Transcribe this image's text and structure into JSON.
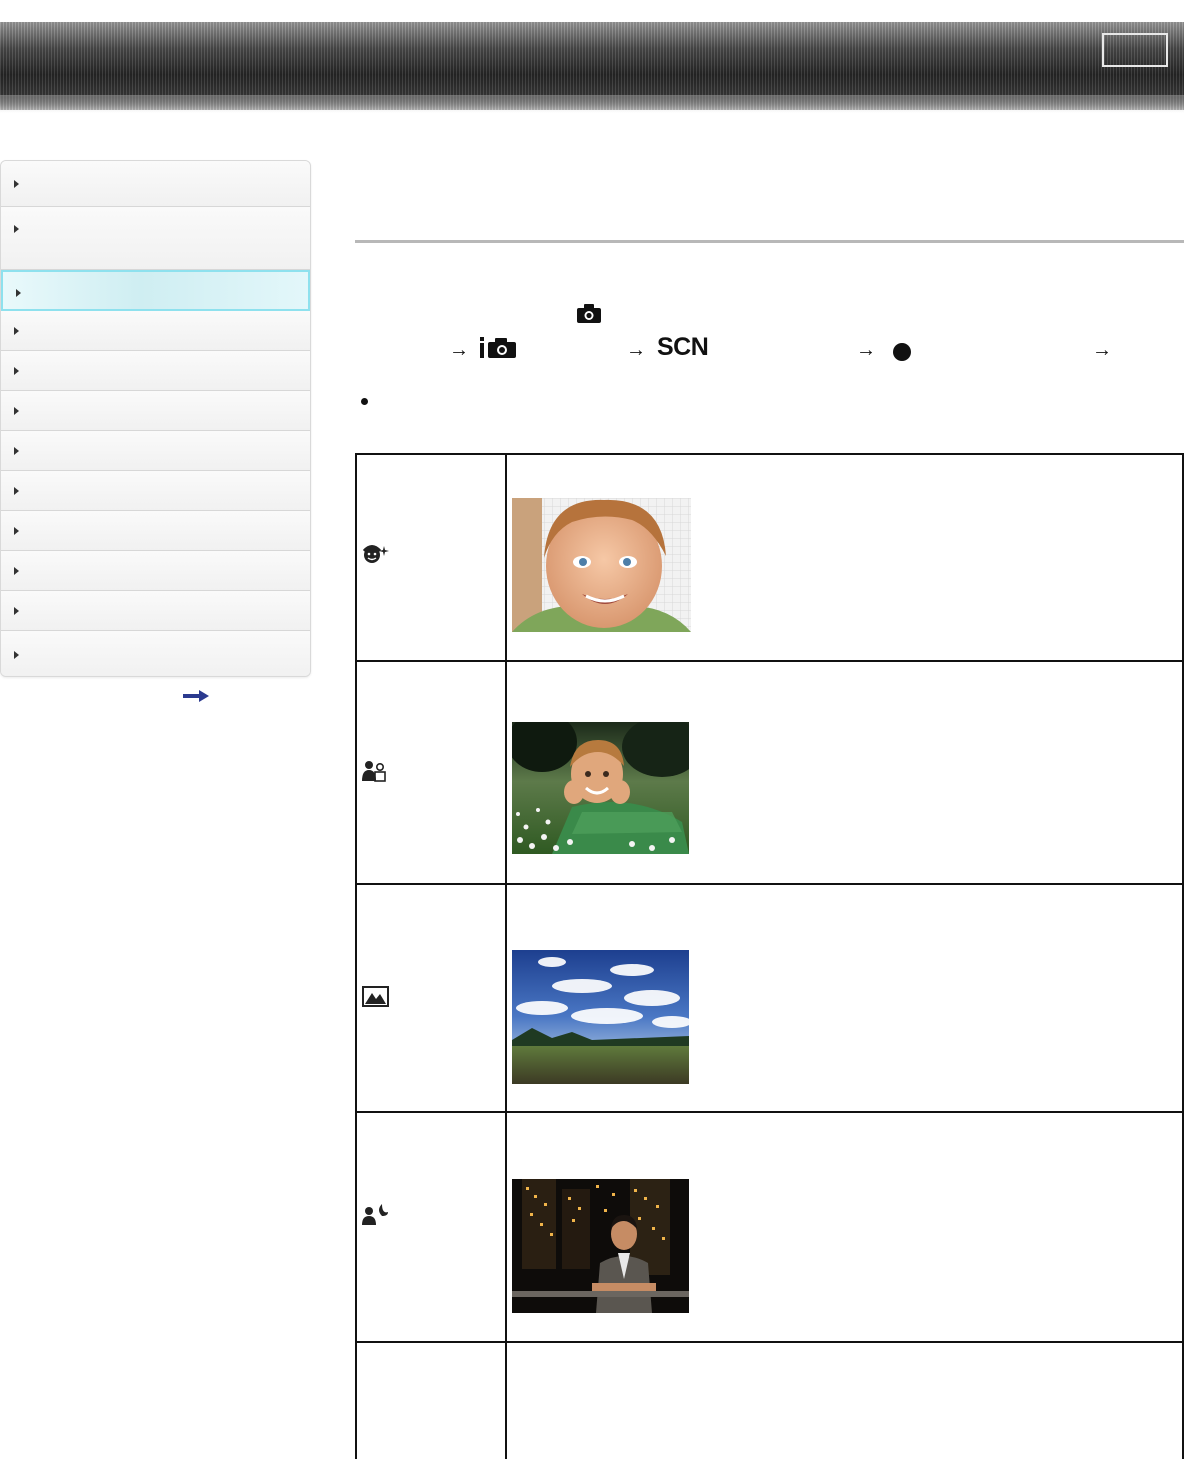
{
  "header": {
    "button_label": ""
  },
  "sidebar": {
    "items": [
      {
        "label": "",
        "active": false
      },
      {
        "label": "",
        "active": false
      },
      {
        "label": "",
        "active": true
      },
      {
        "label": "",
        "active": false
      },
      {
        "label": "",
        "active": false
      },
      {
        "label": "",
        "active": false
      },
      {
        "label": "",
        "active": false
      },
      {
        "label": "",
        "active": false
      },
      {
        "label": "",
        "active": false
      },
      {
        "label": "",
        "active": false
      },
      {
        "label": "",
        "active": false
      },
      {
        "label": "",
        "active": false
      }
    ],
    "more_link_icon": "right-arrow-icon"
  },
  "main": {
    "mode_icon": "camera-icon",
    "menu_path": [
      {
        "arrow": "→",
        "icon": "intelligent-auto-icon"
      },
      {
        "arrow": "→",
        "text": "SCN"
      },
      {
        "arrow": "→",
        "icon": "center-button-icon"
      },
      {
        "arrow": "→"
      }
    ],
    "bullet_icon": "bullet-icon",
    "scenes": [
      {
        "icon": "soft-skin-icon",
        "photo": "smiling-child-closeup"
      },
      {
        "icon": "portrait-icon",
        "photo": "child-lying-in-grass"
      },
      {
        "icon": "landscape-icon",
        "photo": "field-under-blue-sky"
      },
      {
        "icon": "night-portrait-icon",
        "photo": "man-at-night-city"
      },
      {
        "icon": "",
        "photo": ""
      }
    ]
  }
}
